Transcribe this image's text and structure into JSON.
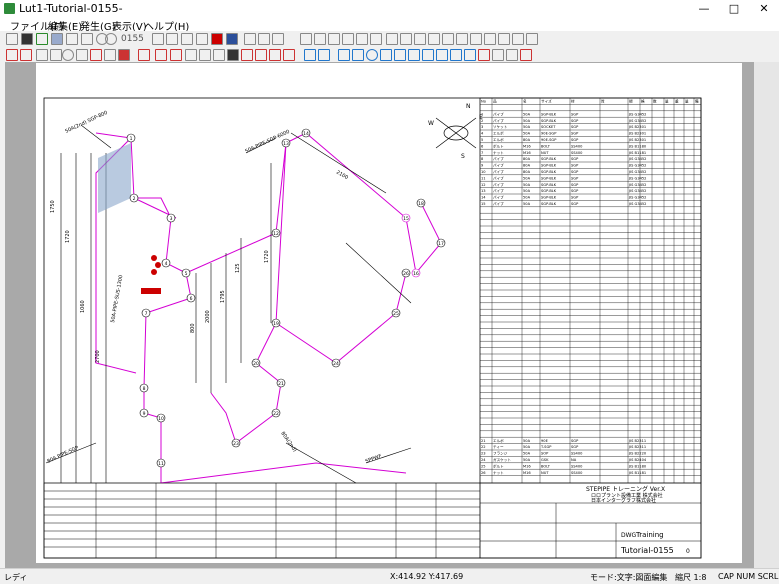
{
  "window": {
    "title": "Lut1-Tutorial-0155-",
    "minimize": "—",
    "maximize": "□",
    "close": "✕"
  },
  "menu": [
    "ファイル(F)",
    "編集(E)",
    "発生(G)",
    "表示(V)",
    "ヘルプ(H)"
  ],
  "toolbar": {
    "counter": "0155"
  },
  "drawing": {
    "nodes": [
      "1",
      "2",
      "3",
      "4",
      "5",
      "6",
      "7",
      "8",
      "9",
      "10",
      "11",
      "12",
      "13",
      "14",
      "15",
      "16",
      "17",
      "18",
      "19",
      "20",
      "21",
      "22",
      "23",
      "24",
      "25",
      "26"
    ],
    "dims": [
      "1750",
      "1720",
      "1060",
      "2700",
      "800",
      "2000",
      "1795",
      "125",
      "2100",
      "1720",
      "1160",
      "820",
      "1295",
      "1200",
      "1400",
      "1500",
      "730",
      "540"
    ],
    "labels": [
      "50A(2nd) SGP-800",
      "50A-PIPE-SUS-1300",
      "50A-PIPE-SGP-6000",
      "80A PIPE-SGP",
      "80A(2nd)",
      "SPPWF",
      "SOCKET-30",
      "BOLT-M-15",
      "BOLT-N-16",
      "ELBOW 90° LR"
    ],
    "compass": {
      "n": "N",
      "e": "E",
      "w": "W",
      "s": "S"
    }
  },
  "bom": {
    "headers": [
      "No",
      "品",
      "名",
      "サイズ",
      "材",
      "質",
      "規",
      "格",
      "数",
      "量",
      "重",
      "量",
      "備",
      "考"
    ],
    "rows": [
      [
        "1",
        "パイプ",
        "50A",
        "SGP-BLK",
        "SGP",
        "",
        "JIS G3452",
        "",
        "",
        "",
        "",
        "",
        "",
        "Ex 100A-1"
      ],
      [
        "2",
        "パイプ",
        "50A",
        "SGP-BLK",
        "SGP",
        "",
        "JIS G3452",
        "",
        "",
        "",
        "",
        "",
        "",
        "Ex 100A-2"
      ],
      [
        "3",
        "ソケット",
        "50A",
        "SOCKET",
        "SGP",
        "",
        "JIS B2301",
        "",
        "",
        "",
        "",
        "",
        "",
        "Ex Green"
      ],
      [
        "4",
        "エルボ",
        "50A",
        "90E-SGP",
        "SGP",
        "",
        "JIS B2301",
        "",
        "",
        "",
        "",
        "",
        "",
        "Ex Green"
      ],
      [
        "5",
        "エルボ",
        "80A",
        "90E-SGP",
        "SGP",
        "",
        "JIS B2301",
        "",
        "",
        "",
        "",
        "",
        "",
        "Ex Green"
      ],
      [
        "6",
        "ボルト",
        "M16",
        "BOLT",
        "SS400",
        "",
        "JIS B1180",
        "",
        "",
        "",
        "",
        "",
        "",
        "Ex 100A-1"
      ],
      [
        "7",
        "ナット",
        "M16",
        "NUT",
        "SS400",
        "",
        "JIS B1181",
        "",
        "",
        "",
        "",
        "",
        "",
        "Ex 100A-2"
      ],
      [
        "8",
        "パイプ",
        "80A",
        "SGP-BLK",
        "SGP",
        "",
        "JIS G3452",
        "",
        "",
        "",
        "",
        "",
        "",
        "Ex 100A-1"
      ],
      [
        "9",
        "パイプ",
        "80A",
        "SGP-BLK",
        "SGP",
        "",
        "JIS G3452",
        "",
        "",
        "",
        "",
        "",
        "",
        "Ex 100A-2"
      ],
      [
        "10",
        "パイプ",
        "80A",
        "SGP-BLK",
        "SGP",
        "",
        "JIS G3452",
        "",
        "",
        "",
        "",
        "",
        "",
        "Ex 100A-3"
      ],
      [
        "11",
        "パイプ",
        "50A",
        "SGP-BLK",
        "SGP",
        "",
        "JIS G3452",
        "",
        "",
        "",
        "",
        "",
        "",
        "Ex 100A-4"
      ],
      [
        "12",
        "パイプ",
        "50A",
        "SGP-BLK",
        "SGP",
        "",
        "JIS G3452",
        "",
        "",
        "",
        "",
        "",
        "",
        "Ex 100A-5"
      ],
      [
        "13",
        "パイプ",
        "50A",
        "SGP-BLK",
        "SGP",
        "",
        "JIS G3452",
        "",
        "",
        "",
        "",
        "",
        "",
        "Ex 100A-6"
      ],
      [
        "14",
        "パイプ",
        "50A",
        "SGP-BLK",
        "SGP",
        "",
        "JIS G3452",
        "",
        "",
        "",
        "",
        "",
        "",
        "Ex 100A-7"
      ],
      [
        "15",
        "パイプ",
        "50A",
        "SGP-BLK",
        "SGP",
        "",
        "JIS G3452",
        "",
        "",
        "",
        "",
        "",
        "",
        "Ex 100A-8"
      ]
    ],
    "lower_rows": [
      [
        "21",
        "エルボ",
        "50A",
        "90E",
        "SGP",
        "",
        "JIS B2311",
        "",
        "",
        "",
        "",
        "",
        "",
        "Ex 100A"
      ],
      [
        "22",
        "ティー",
        "50A",
        "T-SGP",
        "SGP",
        "",
        "JIS B2311",
        "",
        "",
        "",
        "",
        "",
        "",
        "Ex 100A"
      ],
      [
        "23",
        "フランジ",
        "50A",
        "SOP",
        "SS400",
        "",
        "JIS B2220",
        "",
        "",
        "",
        "",
        "",
        "",
        "Ex 100A"
      ],
      [
        "24",
        "ガスケット",
        "50A",
        "GSK",
        "NA",
        "",
        "JIS B2404",
        "",
        "",
        "",
        "",
        "",
        "",
        "Ex 100A"
      ],
      [
        "25",
        "ボルト",
        "M16",
        "BOLT",
        "SS400",
        "",
        "JIS B1180",
        "",
        "",
        "",
        "",
        "",
        "",
        "Ex 100A"
      ],
      [
        "26",
        "ナット",
        "M16",
        "NUT",
        "SS400",
        "",
        "JIS B1181",
        "",
        "",
        "",
        "",
        "",
        "",
        "Ex 100A"
      ]
    ]
  },
  "titleblock": {
    "name1": "STEPIPE トレーニング Ver.X",
    "name2": "ロロプラント設備工業 株式会社",
    "name3": "日本インターグラフ株式会社",
    "dwg_label": "DWG",
    "dwg_name": "Training",
    "dwg_no": "Tutorial-0155",
    "scale": "0"
  },
  "status": {
    "ready": "レディ",
    "coords": "X:414.92 Y:417.69",
    "mode": "モード:文字:図面編集",
    "scale": "縮尺 1:8",
    "keys": "CAP NUM SCRL"
  }
}
